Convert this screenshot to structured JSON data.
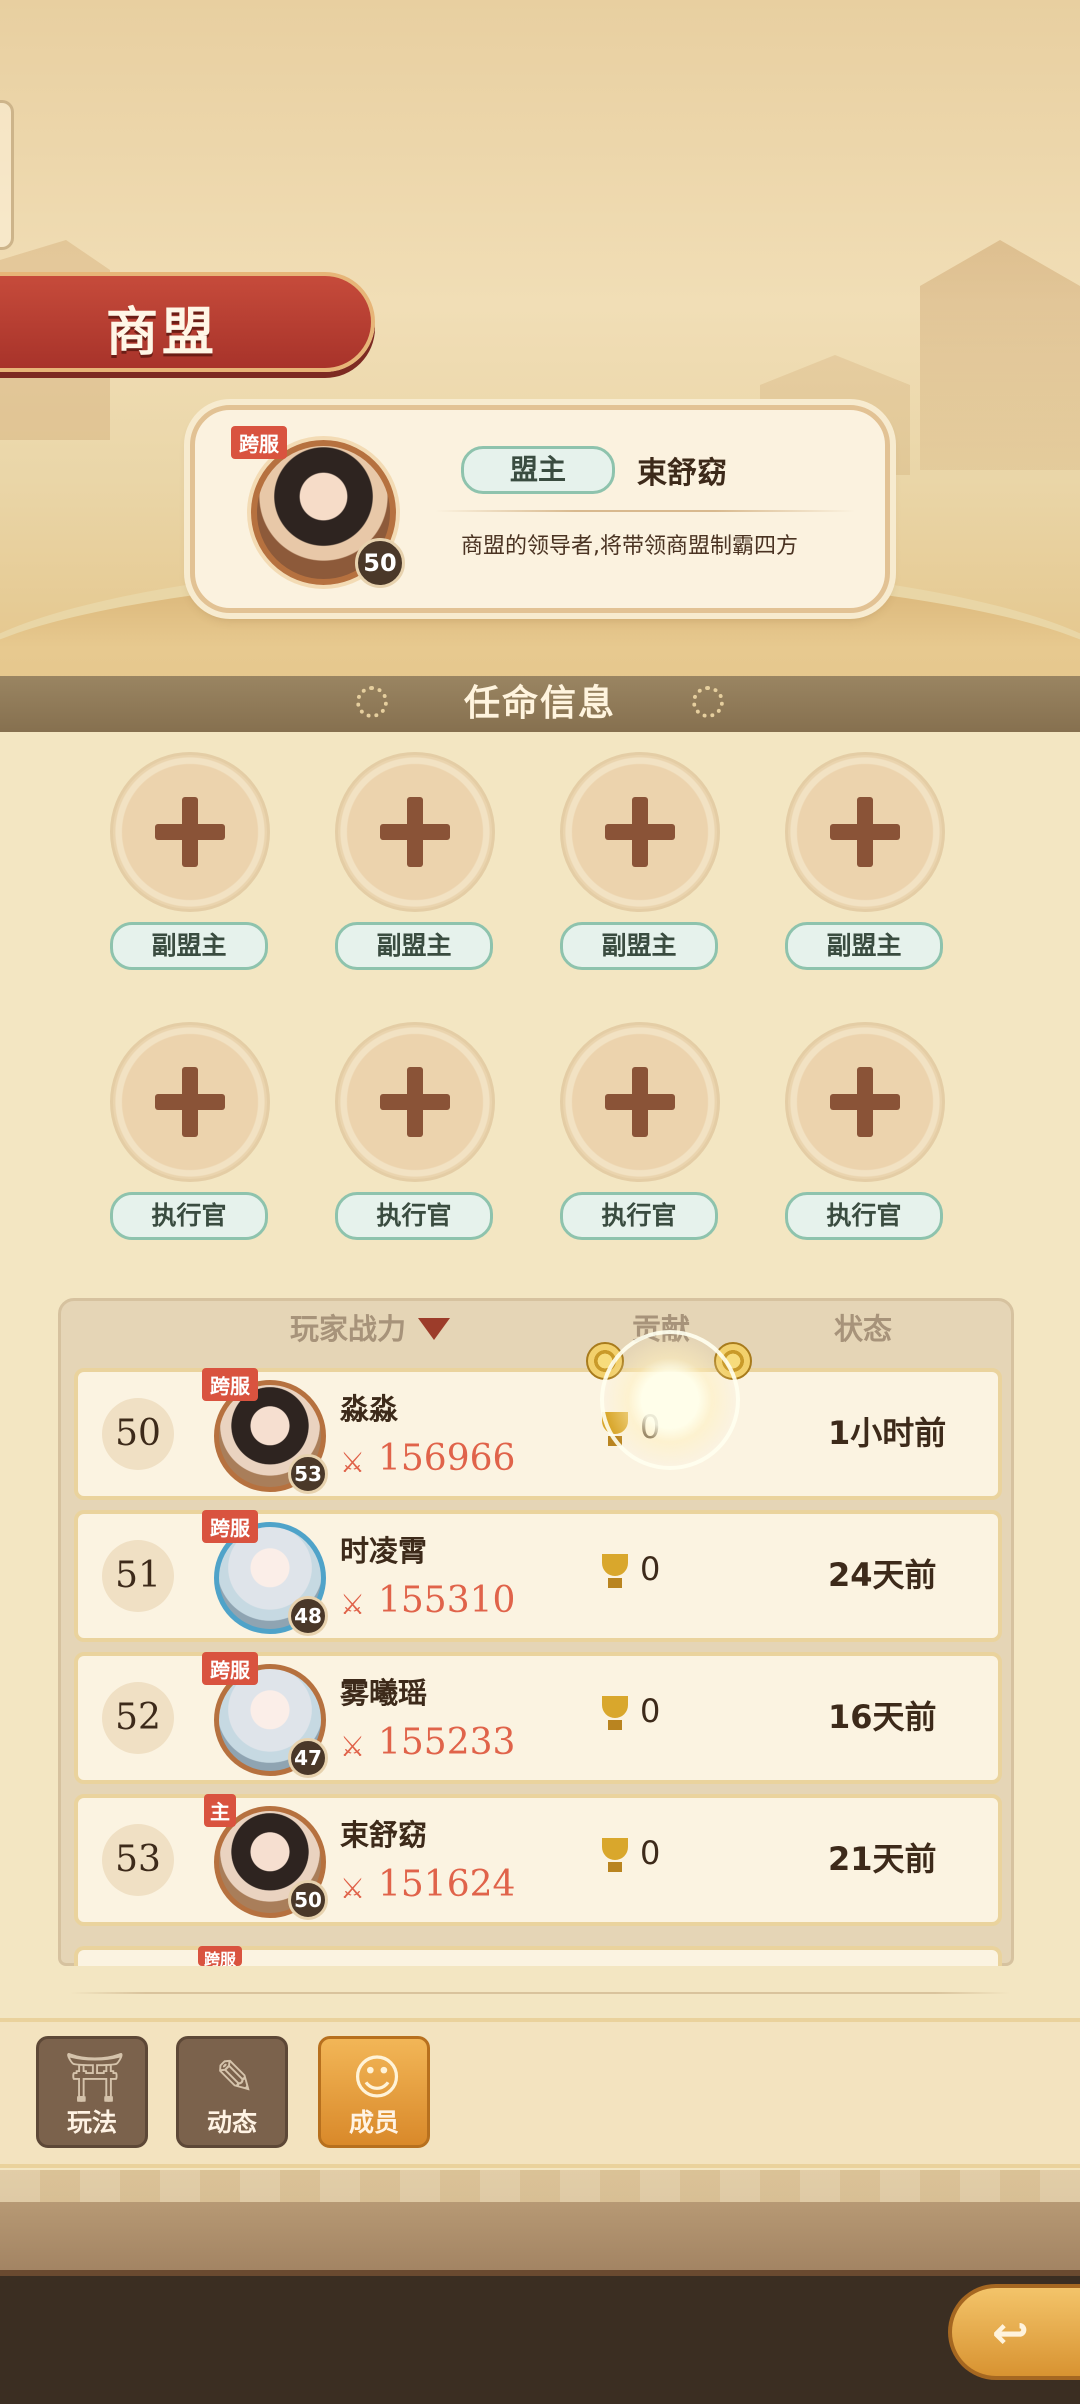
{
  "header": {
    "title": "商盟"
  },
  "leader": {
    "badge": "跨服",
    "level": "50",
    "role": "盟主",
    "name": "束舒窈",
    "description": "商盟的领导者,将带领商盟制霸四方"
  },
  "appointments": {
    "title": "任命信息",
    "slots": [
      {
        "label": "副盟主"
      },
      {
        "label": "副盟主"
      },
      {
        "label": "副盟主"
      },
      {
        "label": "副盟主"
      },
      {
        "label": "执行官"
      },
      {
        "label": "执行官"
      },
      {
        "label": "执行官"
      },
      {
        "label": "执行官"
      }
    ]
  },
  "member_list": {
    "columns": {
      "power": "玩家战力",
      "contribution": "贡献",
      "status": "状态"
    },
    "rows": [
      {
        "rank": "50",
        "badge": "跨服",
        "level": "53",
        "name": "淼淼",
        "power": "156966",
        "contribution": "0",
        "status": "1小时前"
      },
      {
        "rank": "51",
        "badge": "跨服",
        "level": "48",
        "name": "时凌霄",
        "power": "155310",
        "contribution": "0",
        "status": "24天前"
      },
      {
        "rank": "52",
        "badge": "跨服",
        "level": "47",
        "name": "雾曦瑶",
        "power": "155233",
        "contribution": "0",
        "status": "16天前"
      },
      {
        "rank": "53",
        "badge": "主",
        "level": "50",
        "name": "束舒窈",
        "power": "151624",
        "contribution": "0",
        "status": "21天前"
      }
    ],
    "peek_badge": "跨服"
  },
  "bottom_nav": {
    "items": [
      {
        "label": "玩法",
        "icon": "hall-icon"
      },
      {
        "label": "动态",
        "icon": "notes-icon"
      },
      {
        "label": "成员",
        "icon": "members-icon",
        "active": true
      }
    ]
  },
  "colors": {
    "banner": "#b43a2e",
    "accent_power": "#e0634a",
    "nav_active": "#e6a03f"
  }
}
